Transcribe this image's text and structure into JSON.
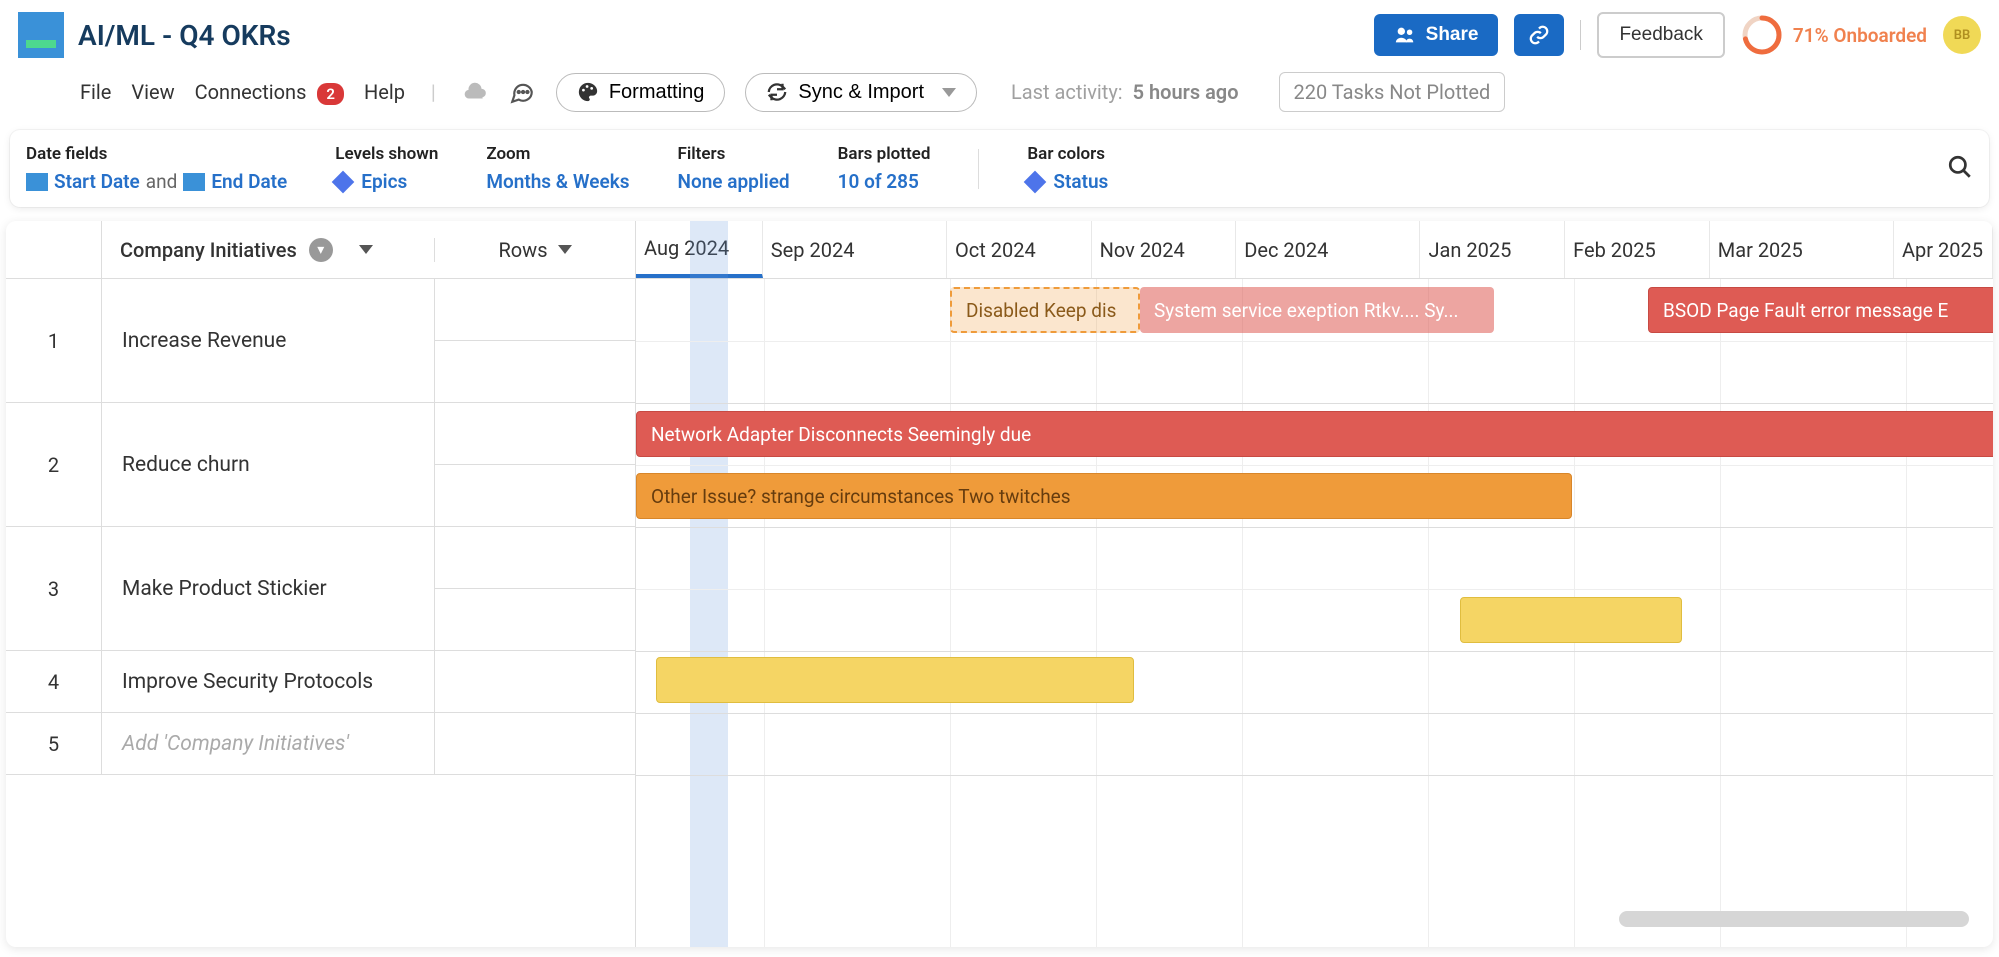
{
  "header": {
    "title": "AI/ML - Q4 OKRs",
    "share": "Share",
    "feedback": "Feedback",
    "onboard_pct": "71% Onboarded",
    "avatar": "BB"
  },
  "menu": {
    "file": "File",
    "view": "View",
    "connections": "Connections",
    "conn_badge": "2",
    "help": "Help",
    "formatting": "Formatting",
    "sync": "Sync & Import",
    "activity_label": "Last activity:",
    "activity_value": "5 hours ago",
    "tasks_not_plotted": "220 Tasks Not Plotted"
  },
  "config": {
    "date_fields_label": "Date fields",
    "start_date": "Start Date",
    "and": "and",
    "end_date": "End Date",
    "levels_label": "Levels shown",
    "levels_value": "Epics",
    "zoom_label": "Zoom",
    "zoom_value": "Months & Weeks",
    "filters_label": "Filters",
    "filters_value": "None applied",
    "bars_label": "Bars plotted",
    "bars_value": "10 of 285",
    "colors_label": "Bar colors",
    "colors_value": "Status"
  },
  "columns": {
    "initiatives": "Company Initiatives",
    "rows": "Rows"
  },
  "rows": [
    {
      "n": "1",
      "label": "Increase Revenue"
    },
    {
      "n": "2",
      "label": "Reduce churn"
    },
    {
      "n": "3",
      "label": "Make Product Stickier"
    },
    {
      "n": "4",
      "label": "Improve Security Protocols"
    },
    {
      "n": "5",
      "label": "Add 'Company Initiatives'"
    }
  ],
  "months": [
    "Aug 2024",
    "Sep 2024",
    "Oct 2024",
    "Nov 2024",
    "Dec 2024",
    "Jan 2025",
    "Feb 2025",
    "Mar 2025",
    "Apr 2025"
  ],
  "bars": {
    "b1a": "Disabled Keep dis",
    "b1b": "System service exeption Rtkv.... Sy...",
    "b1c": "BSOD Page Fault error message E",
    "b2a": "Network Adapter Disconnects Seemingly due",
    "b2b": "Other Issue? strange circumstances Two twitches"
  },
  "colors": {
    "red": "#de5b54",
    "orange": "#ef9b3a",
    "yellow": "#f5d564",
    "blue": "#2670c9"
  }
}
